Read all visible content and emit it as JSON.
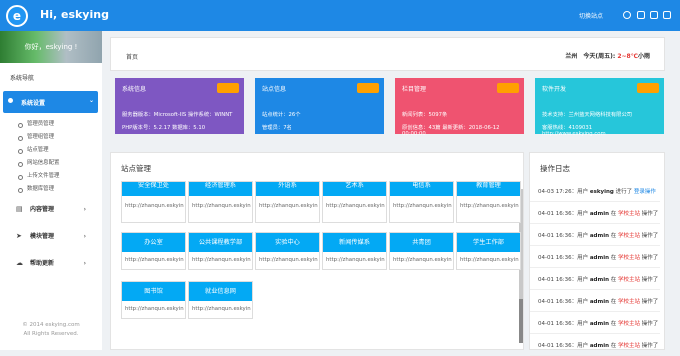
{
  "header": {
    "greeting": "Hi, eskying",
    "switch_label": "切换站点",
    "logo_letter": "e"
  },
  "sidebar": {
    "banner_text": "你好，eskying !",
    "nav_title": "系统导航",
    "active": "系统设置",
    "subs": [
      "管理员管理",
      "管理组管理",
      "站点管理",
      "网站信息配置",
      "上传文件管理",
      "数据库管理"
    ],
    "menus": [
      "内容管理",
      "模块管理",
      "帮助更新"
    ],
    "footer1": "© 2014 eskying.com",
    "footer2": "All Rights Reserved."
  },
  "breadcrumb": {
    "home": "首页",
    "city": "兰州",
    "weather": "今天(周五): ",
    "temp": "2~8℃",
    "extra": "小雨"
  },
  "cards": [
    {
      "title": "系统信息",
      "l1": "服务器版本：Microsoft-IIS 操作系统：WINNT",
      "l2": "PHP版本号：5.2.17                    数据库：5.10",
      "color": "#7e57c2"
    },
    {
      "title": "站点信息",
      "l1": "站点统计：26个",
      "l2": "管理员：7名",
      "color": "#1e88e5"
    },
    {
      "title": "栏目管理",
      "l1": "新闻列表：5097条",
      "l2": "原创信息：43篇 最新更新：2018-06-12 00:00:00",
      "color": "#ef5370"
    },
    {
      "title": "软件开发",
      "l1": "技术支持：兰州蓝天网络科技有限公司",
      "l2": "客服热线：4109031 http://www.eskying.com",
      "color": "#26c6da"
    }
  ],
  "sites": {
    "title": "站点管理",
    "url": "http://zhanqun.eskyin",
    "tiles": [
      "安全保卫处",
      "经济管理系",
      "外语系",
      "艺术系",
      "电信系",
      "教育管理",
      "办公室",
      "公共课程教学部",
      "实验中心",
      "新闻传媒系",
      "共青团",
      "学生工作部",
      "图书馆",
      "就业信息网"
    ]
  },
  "logs": {
    "title": "操作日志",
    "items": [
      {
        "time": "04-03 17:26：",
        "pre": "用户",
        "user": "eskying",
        "mid": "进行了",
        "site": "",
        "act": "登录操作"
      },
      {
        "time": "04-01 16:36：",
        "pre": "用户",
        "user": "admin",
        "mid": "在",
        "site": "学校主站",
        "act": "操作了"
      },
      {
        "time": "04-01 16:36：",
        "pre": "用户",
        "user": "admin",
        "mid": "在",
        "site": "学校主站",
        "act": "操作了"
      },
      {
        "time": "04-01 16:36：",
        "pre": "用户",
        "user": "admin",
        "mid": "在",
        "site": "学校主站",
        "act": "操作了"
      },
      {
        "time": "04-01 16:36：",
        "pre": "用户",
        "user": "admin",
        "mid": "在",
        "site": "学校主站",
        "act": "操作了"
      },
      {
        "time": "04-01 16:36：",
        "pre": "用户",
        "user": "admin",
        "mid": "在",
        "site": "学校主站",
        "act": "操作了"
      },
      {
        "time": "04-01 16:36：",
        "pre": "用户",
        "user": "admin",
        "mid": "在",
        "site": "学校主站",
        "act": "操作了"
      },
      {
        "time": "04-01 16:36：",
        "pre": "用户",
        "user": "admin",
        "mid": "在",
        "site": "学校主站",
        "act": "操作了"
      }
    ]
  }
}
